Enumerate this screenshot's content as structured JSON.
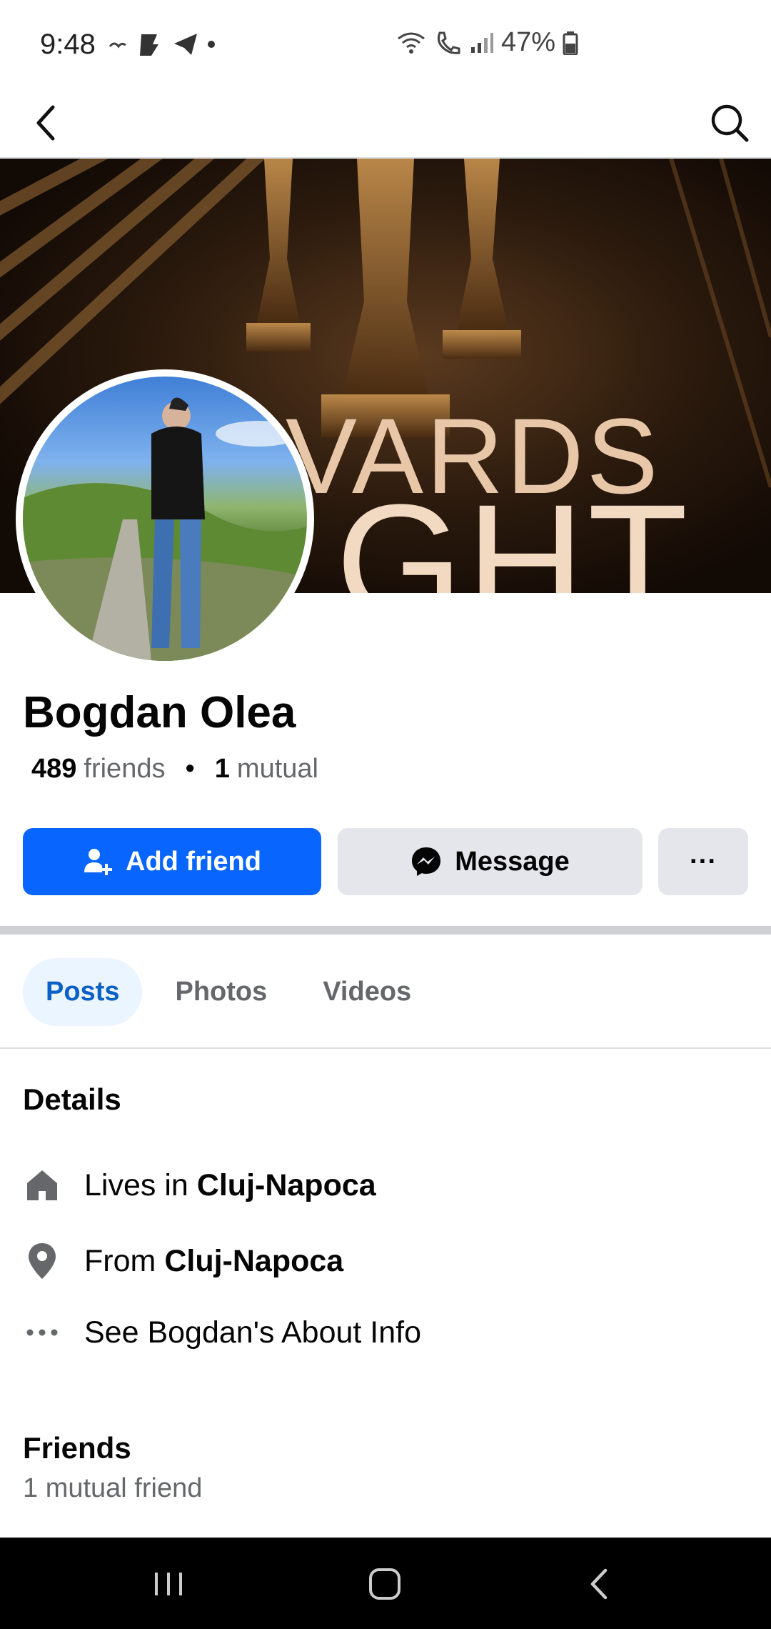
{
  "status_bar": {
    "time": "9:48",
    "battery": "47%"
  },
  "header": {
    "back_icon": "chevron-left-icon",
    "search_icon": "search-icon"
  },
  "cover": {
    "line1": "VARDS",
    "line2": "GHT"
  },
  "profile": {
    "name": "Bogdan Olea",
    "friends_count": "489",
    "friends_label": "friends",
    "separator": "•",
    "mutual_count": "1",
    "mutual_label": "mutual"
  },
  "actions": {
    "add_friend": "Add friend",
    "message": "Message",
    "more": "···"
  },
  "tabs": [
    {
      "label": "Posts",
      "active": true
    },
    {
      "label": "Photos",
      "active": false
    },
    {
      "label": "Videos",
      "active": false
    }
  ],
  "details": {
    "title": "Details",
    "lives_prefix": "Lives in",
    "lives_city": "Cluj-Napoca",
    "from_prefix": "From",
    "from_city": "Cluj-Napoca",
    "about": "See Bogdan's About Info"
  },
  "friends_section": {
    "title": "Friends",
    "subtitle": "1 mutual friend"
  },
  "colors": {
    "primary": "#0866ff",
    "secondary_btn": "#e4e6eb",
    "active_tab_bg": "#ebf5ff",
    "active_tab_text": "#0a60c7",
    "muted_text": "#65676b"
  }
}
